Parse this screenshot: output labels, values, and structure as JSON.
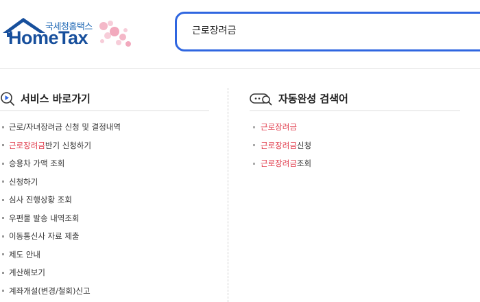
{
  "header": {
    "logo_sub": "국세청홈택스",
    "logo_main": "HomeTax",
    "search_value": "근로장려금"
  },
  "services": {
    "title": "서비스 바로가기",
    "items": [
      {
        "highlight": "",
        "text": "근로/자녀장려금 신청 및 결정내역"
      },
      {
        "highlight": "근로장려금",
        "text": " 반기 신청하기"
      },
      {
        "highlight": "",
        "text": "승용차 가액 조회"
      },
      {
        "highlight": "",
        "text": "신청하기"
      },
      {
        "highlight": "",
        "text": "심사 진행상황 조회"
      },
      {
        "highlight": "",
        "text": "우편물 발송 내역조회"
      },
      {
        "highlight": "",
        "text": "이동통신사 자료 제출"
      },
      {
        "highlight": "",
        "text": "제도 안내"
      },
      {
        "highlight": "",
        "text": "계산해보기"
      },
      {
        "highlight": "",
        "text": "계좌개설(변경/철회)신고"
      }
    ]
  },
  "autocomplete": {
    "title": "자동완성 검색어",
    "items": [
      {
        "highlight": "근로장려금",
        "text": ""
      },
      {
        "highlight": "근로장려금",
        "text": "신청"
      },
      {
        "highlight": "근로장려금",
        "text": "조회"
      }
    ]
  },
  "colors": {
    "accent_blue": "#2f66e0",
    "highlight_red": "#e03a4a",
    "logo_blue": "#174f9c"
  }
}
